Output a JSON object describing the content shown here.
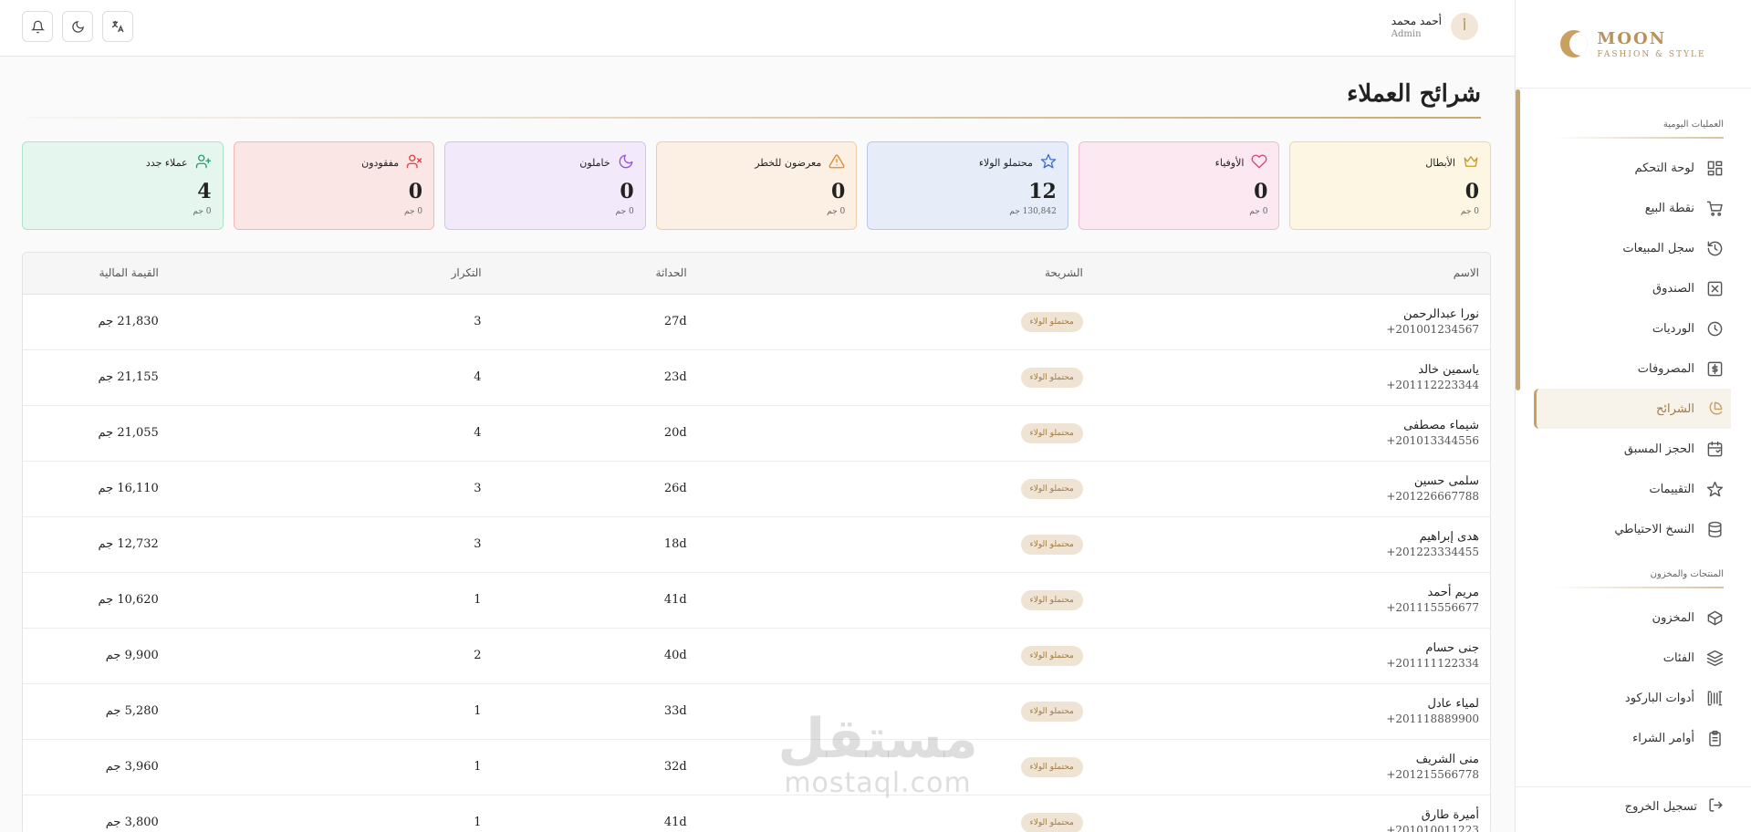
{
  "app": {
    "logo_title": "MOON",
    "logo_sub": "FASHION & STYLE",
    "accent": "#c9a060"
  },
  "header": {
    "user_initial": "أ",
    "user_name": "أحمد محمد",
    "user_role": "Admin",
    "icons": [
      "notification-icon",
      "moon-icon",
      "translate-icon"
    ]
  },
  "sidebar": {
    "section_daily": "العمليات اليومية",
    "daily_items": [
      {
        "label": "لوحة التحكم",
        "icon": "dashboard-icon"
      },
      {
        "label": "نقطة البيع",
        "icon": "cart-icon"
      },
      {
        "label": "سجل المبيعات",
        "icon": "history-icon"
      },
      {
        "label": "الصندوق",
        "icon": "cashbox-icon"
      },
      {
        "label": "الورديات",
        "icon": "clock-icon"
      },
      {
        "label": "المصروفات",
        "icon": "dollar-icon"
      },
      {
        "label": "الشرائح",
        "icon": "pie-chart-icon",
        "active": true
      },
      {
        "label": "الحجز المسبق",
        "icon": "calendar-icon"
      },
      {
        "label": "التقييمات",
        "icon": "star-icon"
      },
      {
        "label": "النسخ الاحتياطي",
        "icon": "database-icon"
      }
    ],
    "section_products": "المنتجات والمخزون",
    "product_items": [
      {
        "label": "المخزون",
        "icon": "box-icon"
      },
      {
        "label": "الفئات",
        "icon": "layers-icon"
      },
      {
        "label": "أدوات الباركود",
        "icon": "barcode-icon"
      },
      {
        "label": "أوامر الشراء",
        "icon": "clipboard-icon"
      }
    ],
    "logout": "تسجيل الخروج"
  },
  "page": {
    "title": "شرائح العملاء"
  },
  "cards": [
    {
      "label": "الأبطال",
      "value": "0",
      "sub": "0 جم",
      "icon": "crown-icon",
      "bg": "#fdf6e3",
      "border": "#ead9a8",
      "icolor": "#c99a2e"
    },
    {
      "label": "الأوفياء",
      "value": "0",
      "sub": "0 جم",
      "icon": "heart-icon",
      "bg": "#fbe8f1",
      "border": "#f0bcd3",
      "icolor": "#d9437e"
    },
    {
      "label": "محتملو الولاء",
      "value": "12",
      "sub": "130,842 جم",
      "icon": "star-icon",
      "bg": "#e6edf9",
      "border": "#b7c8ea",
      "icolor": "#3f6fd1"
    },
    {
      "label": "معرضون للخطر",
      "value": "0",
      "sub": "0 جم",
      "icon": "warning-icon",
      "bg": "#fcefe3",
      "border": "#f1cda6",
      "icolor": "#e08a2e"
    },
    {
      "label": "خاملون",
      "value": "0",
      "sub": "0 جم",
      "icon": "moon-icon",
      "bg": "#f2e9fb",
      "border": "#d8c0ef",
      "icolor": "#9856d6"
    },
    {
      "label": "مفقودون",
      "value": "0",
      "sub": "0 جم",
      "icon": "user-x-icon",
      "bg": "#fbe6e6",
      "border": "#efb9b9",
      "icolor": "#d94444"
    },
    {
      "label": "عملاء جدد",
      "value": "4",
      "sub": "0 جم",
      "icon": "user-plus-icon",
      "bg": "#e5f6ee",
      "border": "#aee3c9",
      "icolor": "#22a06b"
    }
  ],
  "table": {
    "headers": [
      "الاسم",
      "الشريحة",
      "الحداثة",
      "التكرار",
      "القيمة المالية"
    ],
    "rows": [
      {
        "name": "نورا عبدالرحمن",
        "phone": "+201001234567",
        "segment": "محتملو الولاء",
        "recency": "27d",
        "frequency": "3",
        "monetary": "21,830 جم"
      },
      {
        "name": "ياسمين خالد",
        "phone": "+201112223344",
        "segment": "محتملو الولاء",
        "recency": "23d",
        "frequency": "4",
        "monetary": "21,155 جم"
      },
      {
        "name": "شيماء مصطفى",
        "phone": "+201013344556",
        "segment": "محتملو الولاء",
        "recency": "20d",
        "frequency": "4",
        "monetary": "21,055 جم"
      },
      {
        "name": "سلمى حسين",
        "phone": "+201226667788",
        "segment": "محتملو الولاء",
        "recency": "26d",
        "frequency": "3",
        "monetary": "16,110 جم"
      },
      {
        "name": "هدى إبراهيم",
        "phone": "+201223334455",
        "segment": "محتملو الولاء",
        "recency": "18d",
        "frequency": "3",
        "monetary": "12,732 جم"
      },
      {
        "name": "مريم أحمد",
        "phone": "+201115556677",
        "segment": "محتملو الولاء",
        "recency": "41d",
        "frequency": "1",
        "monetary": "10,620 جم"
      },
      {
        "name": "جنى حسام",
        "phone": "+201111122334",
        "segment": "محتملو الولاء",
        "recency": "40d",
        "frequency": "2",
        "monetary": "9,900 جم"
      },
      {
        "name": "لمياء عادل",
        "phone": "+201118889900",
        "segment": "محتملو الولاء",
        "recency": "33d",
        "frequency": "1",
        "monetary": "5,280 جم"
      },
      {
        "name": "منى الشريف",
        "phone": "+201215566778",
        "segment": "محتملو الولاء",
        "recency": "32d",
        "frequency": "1",
        "monetary": "3,960 جم"
      },
      {
        "name": "أميرة طارق",
        "phone": "+201010011223",
        "segment": "محتملو الولاء",
        "recency": "41d",
        "frequency": "1",
        "monetary": "3,800 جم"
      }
    ]
  },
  "watermark": {
    "ar": "مستقل",
    "en": "mostaql.com"
  }
}
